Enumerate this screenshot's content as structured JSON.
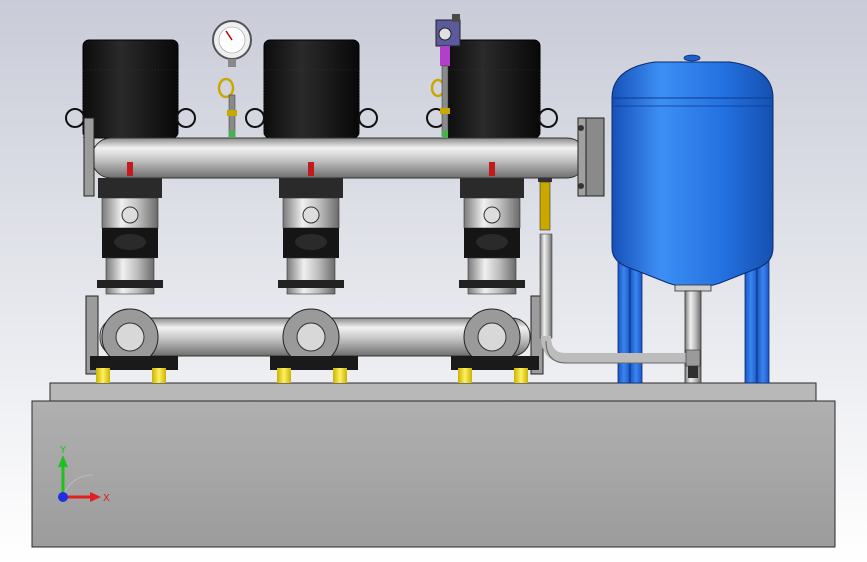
{
  "viewport": {
    "background_top": "#c9ccd8",
    "background_bottom": "#ffffff"
  },
  "model": {
    "pump_count": 3,
    "tank_color": "#1f6fe0",
    "motor_color": "#141414",
    "steel_color": "#c8c8c8",
    "base_color": "#a6a6a6"
  },
  "triad": {
    "x_label": "X",
    "y_label": "Y",
    "x_color": "#e02020",
    "y_color": "#20c020",
    "z_color": "#2030e0"
  }
}
